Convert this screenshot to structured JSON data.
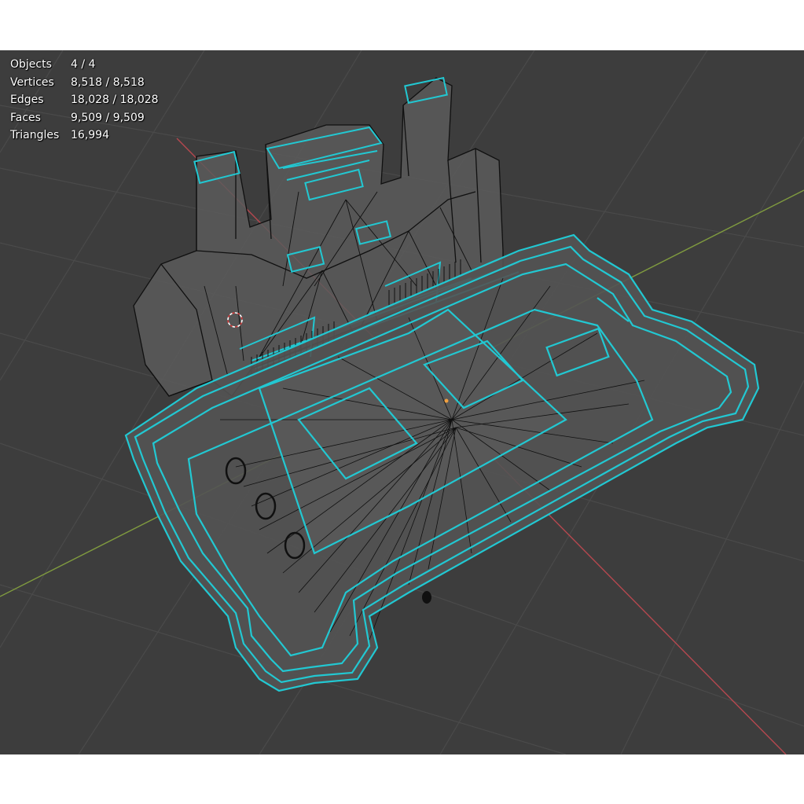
{
  "viewport": {
    "background": "#3d3d3d",
    "grid_color": "#4a4a4a",
    "axis_x_color": "#b5484f",
    "axis_y_color": "#7f9a3f",
    "wire_color": "#101010",
    "selected_edge_color": "#22c8d2",
    "face_color": "#5a5a5a",
    "cursor_icon": "3d-cursor-icon"
  },
  "stats": {
    "objects_label": "Objects",
    "objects_value": "4 / 4",
    "vertices_label": "Vertices",
    "vertices_value": "8,518 / 8,518",
    "edges_label": "Edges",
    "edges_value": "18,028 / 18,028",
    "faces_label": "Faces",
    "faces_value": "9,509 / 9,509",
    "triangles_label": "Triangles",
    "triangles_value": "16,994"
  }
}
